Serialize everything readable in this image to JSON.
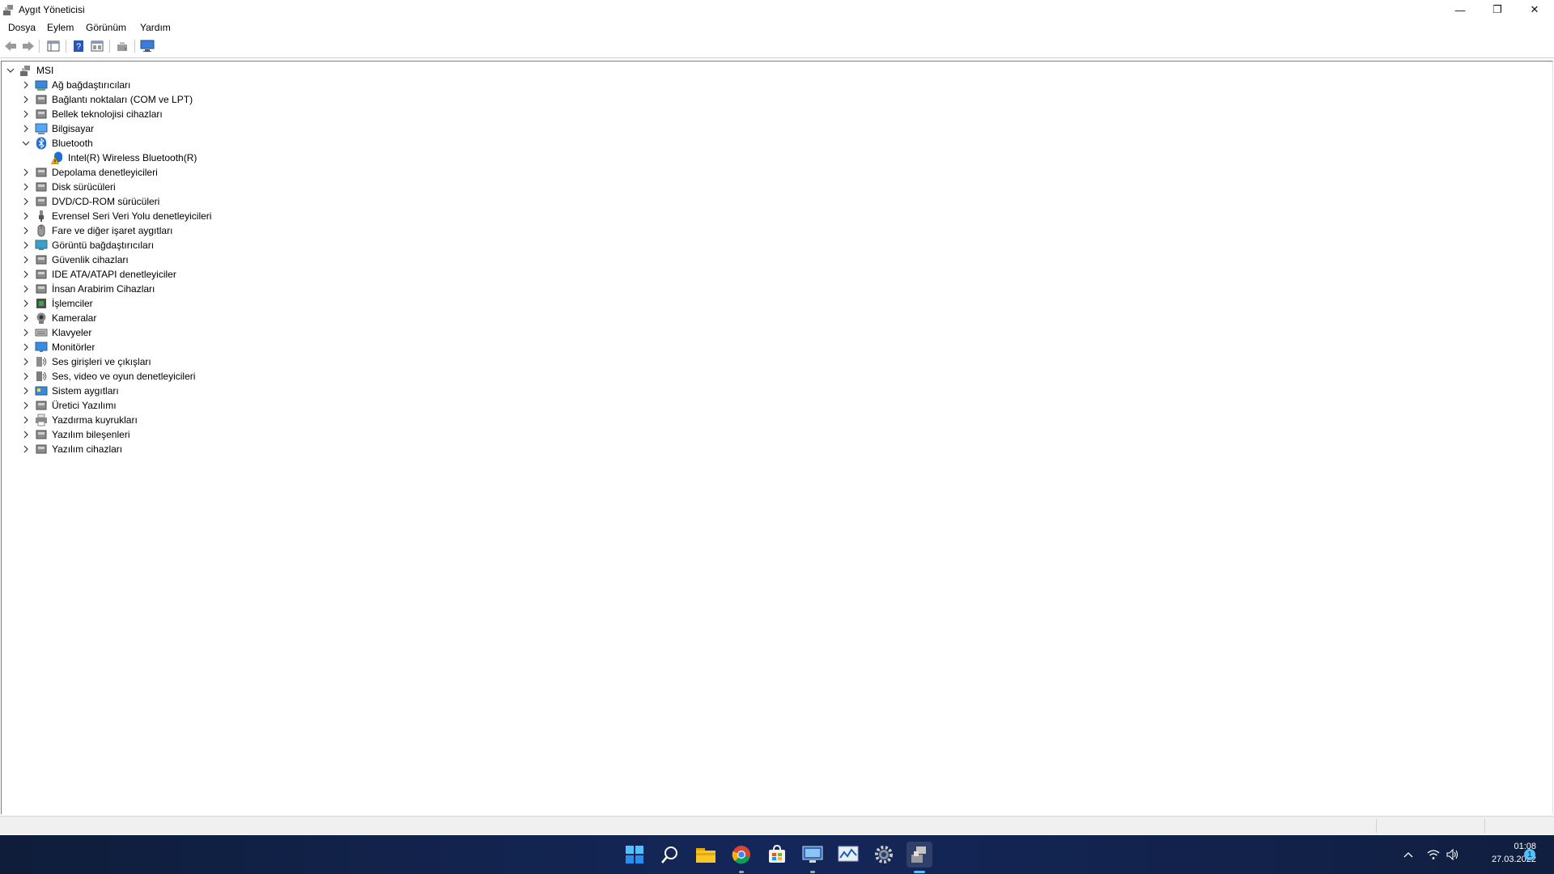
{
  "window": {
    "title": "Aygıt Yöneticisi"
  },
  "menu": [
    "Dosya",
    "Eylem",
    "Görünüm",
    "Yardım"
  ],
  "tree": {
    "root": "MSI",
    "categories": [
      {
        "label": "Ağ bağdaştırıcıları",
        "icon": "network-adapter-icon",
        "expanded": false
      },
      {
        "label": "Bağlantı noktaları (COM ve LPT)",
        "icon": "port-icon",
        "expanded": false
      },
      {
        "label": "Bellek teknolojisi cihazları",
        "icon": "memory-device-icon",
        "expanded": false
      },
      {
        "label": "Bilgisayar",
        "icon": "computer-icon",
        "expanded": false
      },
      {
        "label": "Bluetooth",
        "icon": "bluetooth-icon",
        "expanded": true,
        "children": [
          {
            "label": "Intel(R) Wireless Bluetooth(R)",
            "icon": "bluetooth-warning-icon"
          }
        ]
      },
      {
        "label": "Depolama denetleyicileri",
        "icon": "storage-controller-icon",
        "expanded": false
      },
      {
        "label": "Disk sürücüleri",
        "icon": "disk-drive-icon",
        "expanded": false
      },
      {
        "label": "DVD/CD-ROM sürücüleri",
        "icon": "dvd-drive-icon",
        "expanded": false
      },
      {
        "label": "Evrensel Seri Veri Yolu denetleyicileri",
        "icon": "usb-icon",
        "expanded": false
      },
      {
        "label": "Fare ve diğer işaret aygıtları",
        "icon": "mouse-icon",
        "expanded": false
      },
      {
        "label": "Görüntü bağdaştırıcıları",
        "icon": "display-adapter-icon",
        "expanded": false
      },
      {
        "label": "Güvenlik cihazları",
        "icon": "security-device-icon",
        "expanded": false
      },
      {
        "label": "IDE ATA/ATAPI denetleyiciler",
        "icon": "ide-controller-icon",
        "expanded": false
      },
      {
        "label": "İnsan Arabirim Cihazları",
        "icon": "hid-icon",
        "expanded": false
      },
      {
        "label": "İşlemciler",
        "icon": "processor-icon",
        "expanded": false
      },
      {
        "label": "Kameralar",
        "icon": "camera-icon",
        "expanded": false
      },
      {
        "label": "Klavyeler",
        "icon": "keyboard-icon",
        "expanded": false
      },
      {
        "label": "Monitörler",
        "icon": "monitor-icon",
        "expanded": false
      },
      {
        "label": "Ses girişleri ve çıkışları",
        "icon": "audio-io-icon",
        "expanded": false
      },
      {
        "label": "Ses, video ve oyun denetleyicileri",
        "icon": "sound-controller-icon",
        "expanded": false
      },
      {
        "label": "Sistem aygıtları",
        "icon": "system-device-icon",
        "expanded": false
      },
      {
        "label": "Üretici Yazılımı",
        "icon": "firmware-icon",
        "expanded": false
      },
      {
        "label": "Yazdırma kuyrukları",
        "icon": "printer-icon",
        "expanded": false
      },
      {
        "label": "Yazılım bileşenleri",
        "icon": "software-component-icon",
        "expanded": false
      },
      {
        "label": "Yazılım cihazları",
        "icon": "software-device-icon",
        "expanded": false
      }
    ]
  },
  "taskbar": {
    "apps": [
      "start-icon",
      "search-icon",
      "file-explorer-icon",
      "chrome-icon",
      "store-icon",
      "remote-desktop-icon",
      "resource-monitor-icon",
      "settings-icon",
      "device-manager-icon"
    ],
    "time": "01:08",
    "date": "27.03.2022",
    "notification_count": "1"
  },
  "colors": {
    "taskbar_bg": "#14275a",
    "accent": "#0078d4",
    "warning": "#f2b100"
  }
}
